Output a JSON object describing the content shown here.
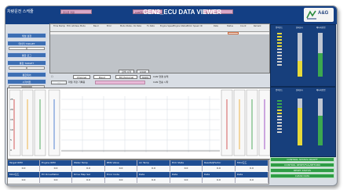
{
  "header": {
    "system_name": "차량운전 스케줄",
    "field1": "캔오픈 지원",
    "field2": "CAN연결 상태",
    "field3": "데이터 저장",
    "title": "GEN2_ECU DATA VIEWER",
    "logo": "A&G"
  },
  "menu": {
    "btn1": "채널 설정",
    "btn2": "데이터 TARGET",
    "val2": "0",
    "btn3": "통합 로그",
    "btn4": "통합 TARGET",
    "val4": "0",
    "btn5": "통합제어",
    "btn6": "시작버튼",
    "val6": "0000000"
  },
  "table": {
    "headers": [
      "Time Stamp",
      "ECU Address",
      "Mode",
      "Baud",
      "Error",
      "Mode Status",
      "Rx Data",
      "Tx Data",
      "Engine Speed",
      "Engine Status",
      "Motor Speed",
      "ID",
      "Data",
      "Status",
      "Count",
      "Remark"
    ]
  },
  "control": {
    "select1": "Channel",
    "select2": "Baud",
    "select3": "Bit_Personal",
    "btn_apply": "Apply",
    "status1": "CAN 연결 상태",
    "status2": "CAN 전송 시작",
    "btn_search": "검색 시작",
    "btn_load": "LOAD",
    "btn_start": "Start",
    "btn_stop": "Stop",
    "btn_save": "Save As",
    "note": "파일 저장 기록용"
  },
  "chart": {
    "y_ticks": [
      "25",
      "20",
      "15",
      "10",
      "5",
      "0"
    ]
  },
  "bottom": {
    "row1_headers": [
      "Target RPM",
      "Engine RPM",
      "Water Temp",
      "BMS Value",
      "Air Temp",
      "ECU State",
      "ReadAdjFactor",
      "MCU모드"
    ],
    "row1_values": [
      "0.0",
      "0.0",
      "0.0",
      "0.0",
      "0.0",
      "0.0",
      "0.0",
      "0.0"
    ],
    "row2_headers": [
      "MCU모드",
      "EV DrivePlaton",
      "Drive Map Sel",
      "Error Code",
      "Data",
      "Data",
      "Data",
      "Data"
    ],
    "row2_values": [
      "0.0",
      "0.0",
      "0.0",
      "0.0",
      "0.0",
      "0.0",
      "0.0",
      "0.0"
    ]
  },
  "right": {
    "panel_headers": [
      "입력모드",
      "상태표시",
      "배터리전압"
    ],
    "panel2_headers": [
      "입력모드",
      "상태표시",
      "배터리전압"
    ],
    "status_buttons": [
      "CONTROL STATUS ON/OFF",
      "CONTROL RESET/FAIL/RETURN",
      "RESET STATUS",
      "CLEAR DATA"
    ]
  },
  "colors": {
    "header": "#133f84",
    "accent": "#3d6fb4",
    "status_green": "#2f9d46",
    "pink_field": "#d9a8c8"
  }
}
